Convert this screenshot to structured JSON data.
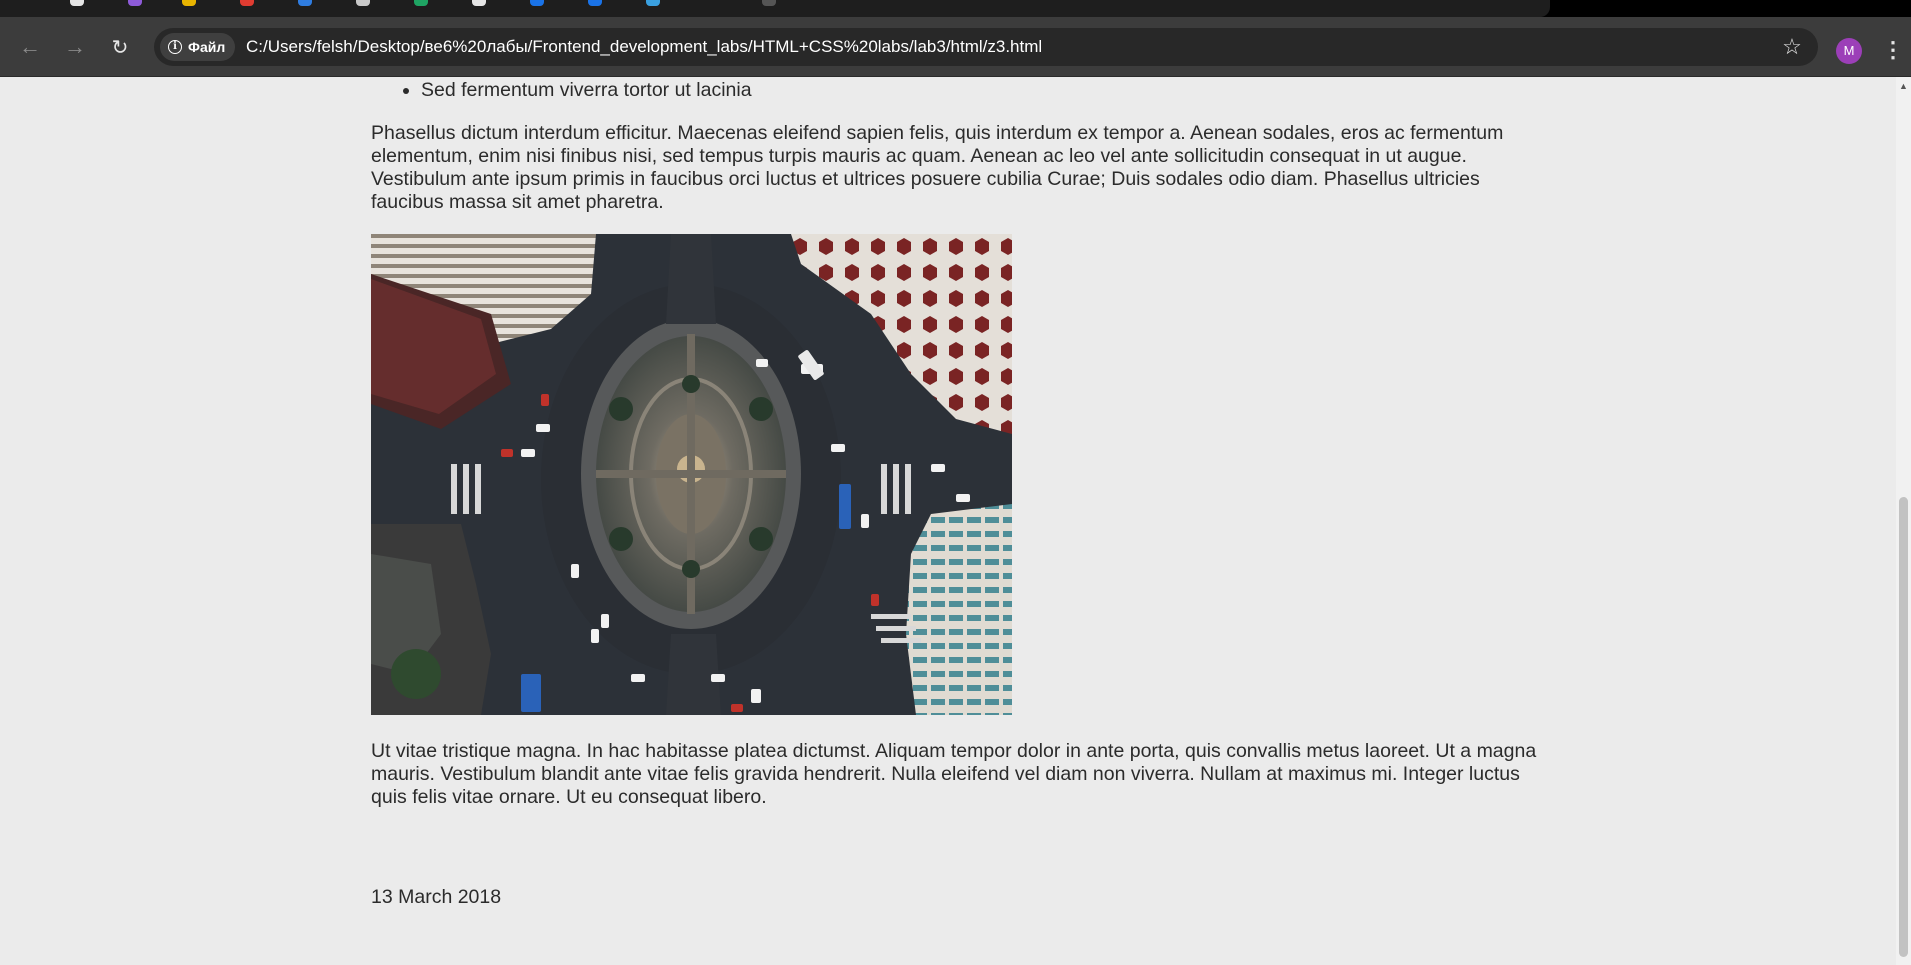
{
  "browser": {
    "back_icon": "arrow-left-icon",
    "forward_icon": "arrow-right-icon",
    "reload_icon": "reload-icon",
    "site_chip_label": "Файл",
    "url": "C:/Users/felsh/Desktop/ве6%20лабы/Frontend_development_labs/HTML+CSS%20labs/lab3/html/z3.html",
    "profile_initial": "M",
    "colors": {
      "toolbar": "#3c3c3c",
      "omnibox": "#282828",
      "avatar": "#9c3fb8"
    }
  },
  "page": {
    "list_items": [
      "Sed fermentum viverra tortor ut lacinia"
    ],
    "paragraph1": "Phasellus dictum interdum efficitur. Maecenas eleifend sapien felis, quis interdum ex tempor a. Aenean sodales, eros ac fermentum elementum, enim nisi finibus nisi, sed tempus turpis mauris ac quam. Aenean ac leo vel ante sollicitudin consequat in ut augue. Vestibulum ante ipsum primis in faucibus orci luctus et ultrices posuere cubilia Curae; Duis sodales odio diam. Phasellus ultricies faucibus massa sit amet pharetra.",
    "image_subject": "aerial view of a city roundabout",
    "paragraph2": "Ut vitae tristique magna. In hac habitasse platea dictumst. Aliquam tempor dolor in ante porta, quis convallis metus laoreet. Ut a magna mauris. Vestibulum blandit ante vitae felis gravida hendrerit. Nulla eleifend vel diam non viverra. Nullam at maximus mi. Integer luctus quis felis vitae ornare. Ut eu consequat libero.",
    "date": "13 March 2018"
  }
}
